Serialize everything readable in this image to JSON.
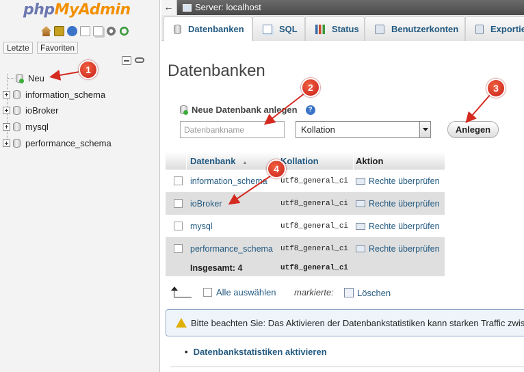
{
  "navigation": {
    "logo_php": "php",
    "logo_myadmin": "MyAdmin",
    "icons": [
      "home-icon",
      "exit-icon",
      "help-icon",
      "document-icon",
      "documents-icon",
      "settings-icon",
      "reload-icon"
    ],
    "recent_label": "Letzte",
    "favorites_label": "Favoriten",
    "tree": [
      {
        "label": "Neu",
        "type": "new"
      },
      {
        "label": "information_schema",
        "type": "database"
      },
      {
        "label": "ioBroker",
        "type": "database"
      },
      {
        "label": "mysql",
        "type": "database"
      },
      {
        "label": "performance_schema",
        "type": "database"
      }
    ]
  },
  "topbar": {
    "back_label": "←",
    "server_label": "Server: localhost"
  },
  "tabs": [
    {
      "label": "Datenbanken",
      "icon": "database-icon",
      "active": true
    },
    {
      "label": "SQL",
      "icon": "sql-icon"
    },
    {
      "label": "Status",
      "icon": "status-icon"
    },
    {
      "label": "Benutzerkonten",
      "icon": "users-icon"
    },
    {
      "label": "Exportie",
      "icon": "export-icon"
    }
  ],
  "main": {
    "title": "Datenbanken",
    "create": {
      "label": "Neue Datenbank anlegen",
      "name_placeholder": "Datenbankname",
      "collation_value": "Kollation",
      "button_label": "Anlegen"
    },
    "table": {
      "headers": {
        "name": "Datenbank",
        "sort": "▲",
        "collation": "Kollation",
        "action": "Aktion"
      },
      "rows": [
        {
          "name": "information_schema",
          "collation": "utf8_general_ci",
          "action": "Rechte überprüfen"
        },
        {
          "name": "ioBroker",
          "collation": "utf8_general_ci",
          "action": "Rechte überprüfen"
        },
        {
          "name": "mysql",
          "collation": "utf8_general_ci",
          "action": "Rechte überprüfen"
        },
        {
          "name": "performance_schema",
          "collation": "utf8_general_ci",
          "action": "Rechte überprüfen"
        }
      ],
      "total": {
        "label": "Insgesamt: 4",
        "collation": "utf8_general_ci"
      }
    },
    "bulk": {
      "select_all": "Alle auswählen",
      "marked": "markierte:",
      "delete": "Löschen"
    },
    "notice": "Bitte beachten Sie: Das Aktivieren der Datenbankstatistiken kann starken Traffic zwis",
    "stats_link": "Datenbankstatistiken aktivieren",
    "stats_bullet": "•"
  },
  "annotations": [
    "1",
    "2",
    "3",
    "4"
  ],
  "colors": {
    "link": "#235a81",
    "annotation": "#d42a20",
    "logo_php": "#6c78af",
    "logo_myadmin": "#f29000"
  }
}
